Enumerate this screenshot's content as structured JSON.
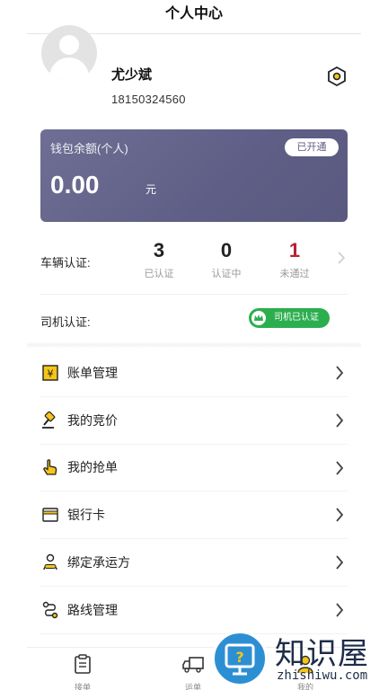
{
  "header": {
    "title": "个人中心"
  },
  "profile": {
    "name": "尤少斌",
    "phone": "18150324560"
  },
  "wallet": {
    "title": "钱包余额(个人)",
    "status": "已开通",
    "amount": "0.00",
    "unit": "元"
  },
  "vehicle": {
    "label": "车辆认证:",
    "stats": [
      {
        "value": "3",
        "label": "已认证"
      },
      {
        "value": "0",
        "label": "认证中"
      },
      {
        "value": "1",
        "label": "未通过"
      }
    ]
  },
  "driver": {
    "label": "司机认证:",
    "badge": "司机已认证"
  },
  "menu": [
    {
      "label": "账单管理",
      "icon": "bill-icon"
    },
    {
      "label": "我的竞价",
      "icon": "gavel-icon"
    },
    {
      "label": "我的抢单",
      "icon": "hand-tap-icon"
    },
    {
      "label": "银行卡",
      "icon": "bank-card-icon"
    },
    {
      "label": "绑定承运方",
      "icon": "carrier-bind-icon"
    },
    {
      "label": "路线管理",
      "icon": "route-icon"
    }
  ],
  "tabbar": [
    {
      "label": "接单",
      "icon": "clipboard-icon"
    },
    {
      "label": "运单",
      "icon": "truck-icon"
    },
    {
      "label": "我的",
      "icon": "user-icon"
    }
  ],
  "watermark": {
    "text": "知识屋",
    "url": "zhishiwu.com"
  },
  "colors": {
    "accent_yellow": "#f5c518",
    "wallet_purple": "#67668e",
    "success_green": "#2cae4f",
    "error_red": "#b82036"
  }
}
